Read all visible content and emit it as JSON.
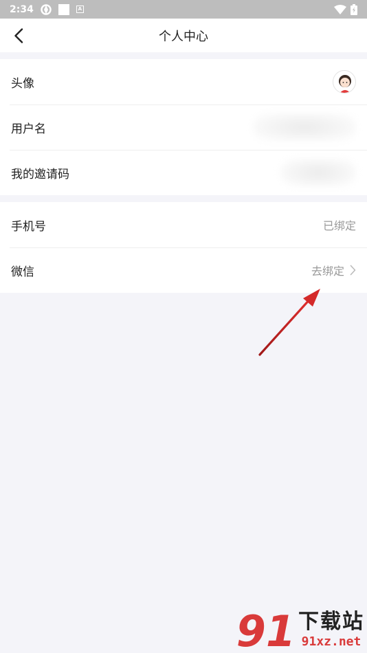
{
  "status_bar": {
    "time": "2:34"
  },
  "header": {
    "title": "个人中心"
  },
  "section1": {
    "avatar_label": "头像",
    "username_label": "用户名",
    "invite_label": "我的邀请码"
  },
  "section2": {
    "phone_label": "手机号",
    "phone_value": "已绑定",
    "wechat_label": "微信",
    "wechat_value": "去绑定"
  },
  "watermark": {
    "logo": "91",
    "title": "下载站",
    "site": "91xz.net"
  },
  "colors": {
    "accent": "#d93a3a",
    "background": "#f4f4f9",
    "muted": "#999999"
  },
  "icons": [
    "back-arrow-icon",
    "chevron-right-icon",
    "avatar-icon",
    "wifi-icon",
    "battery-icon"
  ]
}
